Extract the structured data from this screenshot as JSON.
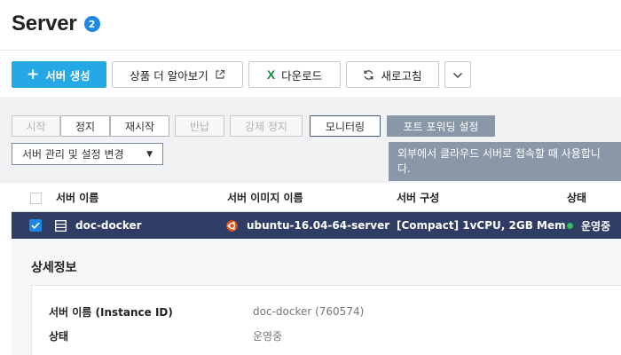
{
  "page": {
    "title": "Server",
    "badge_count": "2"
  },
  "toolbar": {
    "create_label": "서버 생성",
    "learn_more_label": "상품 더 알아보기",
    "download_label": "다운로드",
    "refresh_label": "새로고침",
    "more_icon": "chevron-down-icon"
  },
  "actions": {
    "start": "시작",
    "stop": "정지",
    "restart": "재시작",
    "return": "반납",
    "force_stop": "강제 정지",
    "monitoring": "모니터링",
    "port_forwarding": "포트 포워딩 설정"
  },
  "manage_dropdown": {
    "label": "서버 관리 및 설정 변경"
  },
  "tooltip": {
    "text": "외부에서 클라우드 서버로 접속할 때 사용합니다."
  },
  "table": {
    "columns": [
      "서버 이름",
      "서버 이미지 이름",
      "서버 구성",
      "상태"
    ],
    "rows": [
      {
        "name": "doc-docker",
        "image": "ubuntu-16.04-64-server",
        "spec": "[Compact] 1vCPU, 2GB Mem",
        "status": "운영중",
        "selected": true
      }
    ]
  },
  "detail": {
    "heading": "상세정보",
    "fields": [
      {
        "label": "서버 이름 (Instance ID)",
        "value": "doc-docker (760574)"
      },
      {
        "label": "상태",
        "value": "운영중"
      }
    ]
  },
  "colors": {
    "primary": "#24a8e6",
    "selected_row": "#2f3c63",
    "tooltip": "#8a97a8",
    "status_running": "#2fbf5a",
    "badge": "#1e88e5"
  }
}
